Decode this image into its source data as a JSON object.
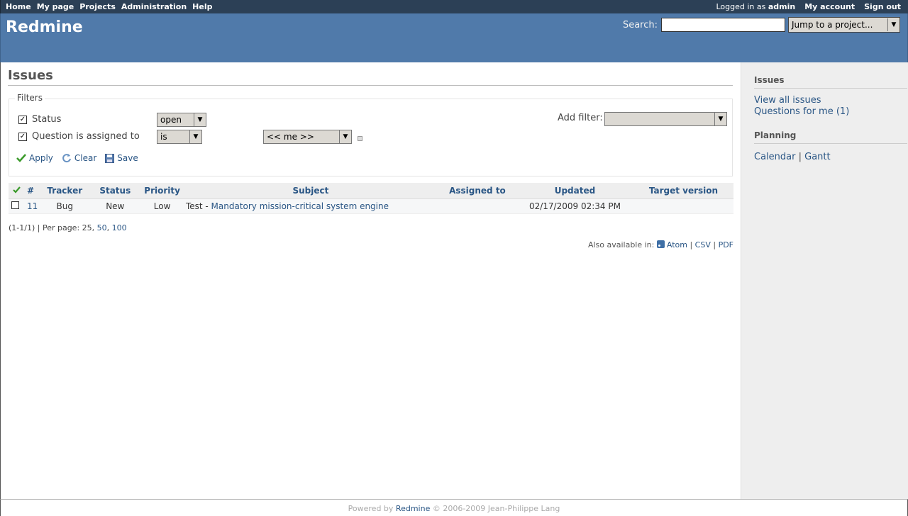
{
  "top_menu": {
    "items": [
      "Home",
      "My page",
      "Projects",
      "Administration",
      "Help"
    ],
    "logged_as_prefix": "Logged in as",
    "logged_user": "admin",
    "my_account": "My account",
    "sign_out": "Sign out"
  },
  "header": {
    "title": "Redmine",
    "search_label": "Search:",
    "search_value": "",
    "jump_label": "Jump to a project..."
  },
  "content": {
    "title": "Issues",
    "filters": {
      "legend": "Filters",
      "rows": [
        {
          "label": "Status",
          "checked": true,
          "operator": "open"
        },
        {
          "label": "Question is assigned to",
          "checked": true,
          "operator": "is",
          "value": "<< me >>"
        }
      ],
      "add_filter_label": "Add filter:",
      "add_filter_value": "",
      "apply": "Apply",
      "clear": "Clear",
      "save": "Save"
    },
    "table": {
      "headers": [
        "#",
        "Tracker",
        "Status",
        "Priority",
        "Subject",
        "Assigned to",
        "Updated",
        "Target version"
      ],
      "rows": [
        {
          "id": "11",
          "tracker": "Bug",
          "status": "New",
          "priority": "Low",
          "subject_prefix": "Test - ",
          "subject_link": "Mandatory mission-critical system engine",
          "assigned_to": "",
          "updated": "02/17/2009 02:34 PM",
          "target_version": ""
        }
      ]
    },
    "pagination": {
      "range": "(1-1/1) | Per page: 25,",
      "opt_50": "50",
      "opt_100": "100"
    },
    "other_formats": {
      "label": "Also available in:",
      "atom": "Atom",
      "csv": "CSV",
      "pdf": "PDF"
    }
  },
  "sidebar": {
    "issues_heading": "Issues",
    "view_all": "View all issues",
    "questions_for_me": "Questions for me (1)",
    "planning_heading": "Planning",
    "calendar": "Calendar",
    "gantt": "Gantt"
  },
  "footer": {
    "powered_by": "Powered by",
    "redmine": "Redmine",
    "copyright": "© 2006-2009 Jean-Philippe Lang"
  },
  "colors": {
    "header_bg": "#507aaa",
    "top_menu_bg": "#2c4056",
    "link": "#2a5685",
    "sidebar_bg": "#eeeeee"
  }
}
